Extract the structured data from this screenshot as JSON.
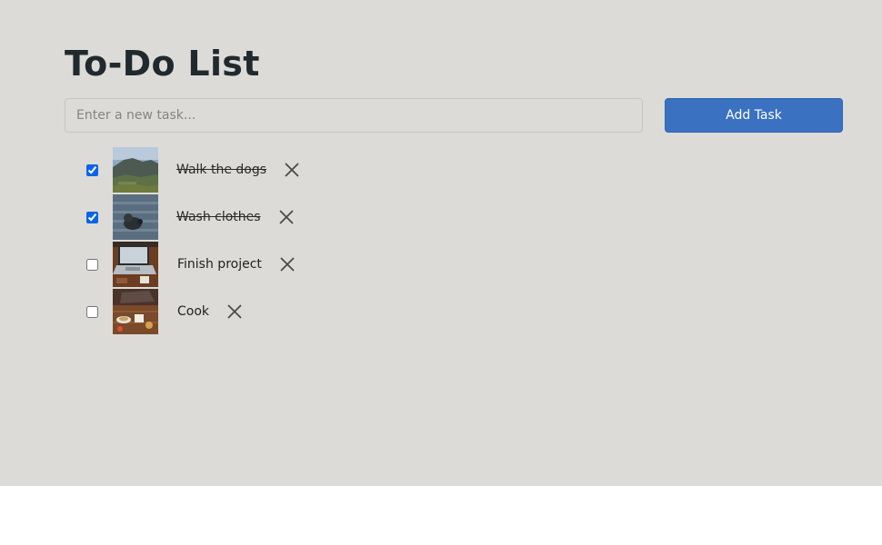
{
  "header": {
    "title": "To-Do List"
  },
  "new_task": {
    "placeholder": "Enter a new task...",
    "value": "",
    "add_label": "Add Task"
  },
  "tasks": [
    {
      "label": "Walk the dogs",
      "completed": true,
      "image": "mountain-landscape"
    },
    {
      "label": "Wash clothes",
      "completed": true,
      "image": "dog-on-wooden-deck"
    },
    {
      "label": "Finish project",
      "completed": false,
      "image": "laptop-on-wooden-desk"
    },
    {
      "label": "Cook",
      "completed": false,
      "image": "food-on-wooden-table"
    }
  ],
  "icons": {
    "delete": "close-icon"
  },
  "colors": {
    "background": "#dcdbd8",
    "accent": "#3a71c1",
    "text": "#202a2e"
  }
}
